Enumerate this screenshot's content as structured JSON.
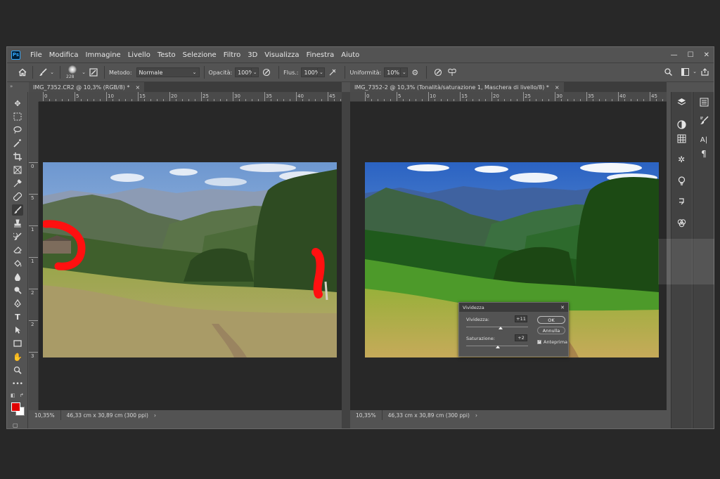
{
  "menubar": {
    "logo": "Ps",
    "items": [
      "File",
      "Modifica",
      "Immagine",
      "Livello",
      "Testo",
      "Selezione",
      "Filtro",
      "3D",
      "Visualizza",
      "Finestra",
      "Aiuto"
    ],
    "controls": [
      "—",
      "☐",
      "✕"
    ]
  },
  "options": {
    "brush_size": "228",
    "metodo_label": "Metodo:",
    "metodo_value": "Normale",
    "opacita_label": "Opacità:",
    "opacita_value": "100%",
    "flusso_label": "Flus.:",
    "flusso_value": "100%",
    "uniformita_label": "Uniformità:",
    "uniformita_value": "10%"
  },
  "documents": [
    {
      "tab_title": "IMG_7352.CR2 @ 10,3% (RGB/8) *",
      "close": "×",
      "ruler_h": [
        "0",
        "5",
        "10",
        "15",
        "20",
        "25",
        "30",
        "35",
        "40",
        "45"
      ],
      "ruler_v": [
        "0",
        "5",
        "1",
        "1",
        "2",
        "2",
        "3"
      ],
      "zoom": "10,35%",
      "doc_size": "46,33 cm x 30,89 cm (300 ppi)",
      "arrow": "›"
    },
    {
      "tab_title": "IMG_7352-2 @ 10,3% (Tonalità/saturazione 1, Maschera di livello/8) *",
      "close": "×",
      "ruler_h": [
        "0",
        "5",
        "10",
        "15",
        "20",
        "25",
        "30",
        "35",
        "40",
        "45"
      ],
      "zoom": "10,35%",
      "doc_size": "46,33 cm x 30,89 cm (300 ppi)",
      "arrow": "›"
    }
  ],
  "dialog": {
    "title": "Vividezza",
    "close": "✕",
    "vividezza_label": "Vividezza:",
    "vividezza_value": "+11",
    "saturazione_label": "Saturazione:",
    "saturazione_value": "+2",
    "ok_label": "OK",
    "annulla_label": "Annulla",
    "anteprima_label": "Anteprima",
    "anteprima_checked": true,
    "vividezza_level": 0.555,
    "saturazione_level": 0.51
  },
  "colors": {
    "foreground": "#e00000",
    "background": "#ffffff",
    "accent": "#31a8ff"
  },
  "tool_icons": [
    "move-icon",
    "marquee-icon",
    "lasso-icon",
    "magic-wand-icon",
    "crop-icon",
    "frame-icon",
    "eyedropper-icon",
    "healing-brush-icon",
    "brush-icon",
    "clone-stamp-icon",
    "history-brush-icon",
    "eraser-icon",
    "paint-bucket-icon",
    "blur-icon",
    "dodge-icon",
    "pen-icon",
    "type-icon",
    "path-select-icon",
    "rectangle-icon",
    "hand-icon",
    "zoom-icon",
    "more-tools-icon"
  ]
}
